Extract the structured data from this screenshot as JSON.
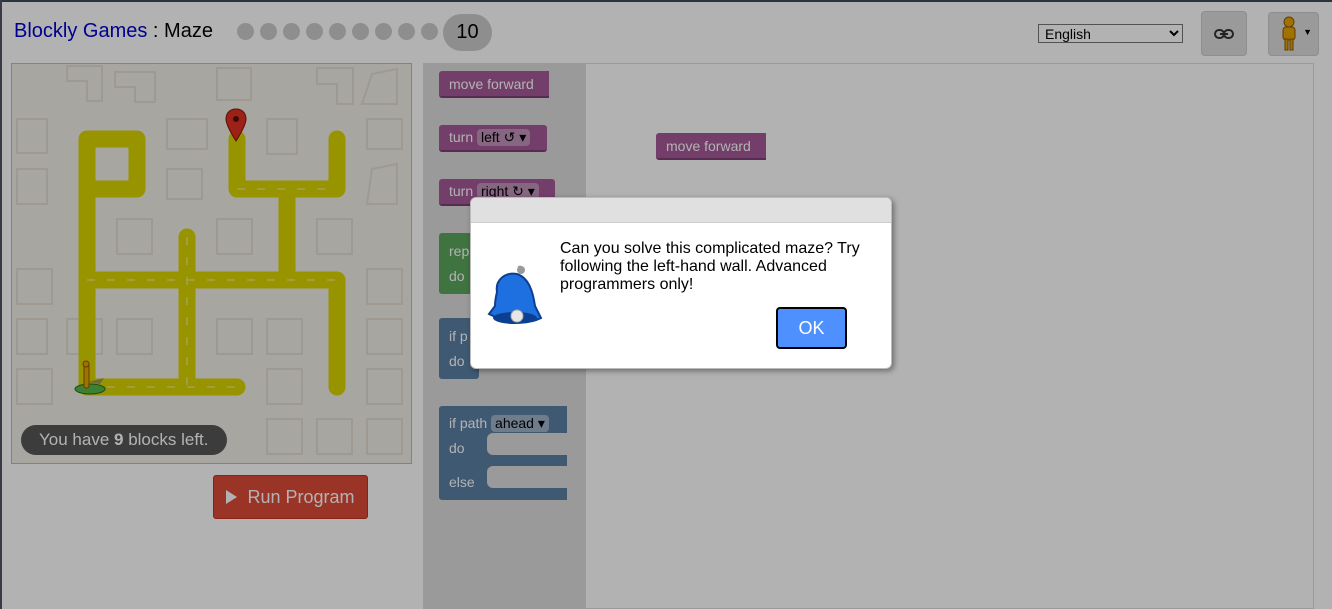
{
  "header": {
    "app_name": "Blockly Games",
    "separator": " : ",
    "game_name": "Maze",
    "levels": [
      "1",
      "2",
      "3",
      "4",
      "5",
      "6",
      "7",
      "8",
      "9",
      "10"
    ],
    "current_level": "10",
    "language": "English",
    "link_icon": "link-icon",
    "pegman_icon": "pegman-icon"
  },
  "maze": {
    "start_icon": "pegman-icon",
    "goal_icon": "map-marker-icon",
    "capacity_prefix": "You have ",
    "capacity_count": "9",
    "capacity_suffix": " blocks left."
  },
  "run_button": {
    "label": "Run Program",
    "icon": "play-icon"
  },
  "toolbox": {
    "move_forward": "move forward",
    "turn_label": "turn",
    "turn_left": "left ↺",
    "turn_right": "right ↻",
    "repeat_label": "rep",
    "repeat_do": "do",
    "if_label": "if p",
    "if_do": "do",
    "ifelse_if": "if path",
    "ifelse_dir": "ahead",
    "ifelse_do": "do",
    "ifelse_else": "else"
  },
  "workspace": {
    "block_label": "move forward"
  },
  "dialog": {
    "message": "Can you solve this complicated maze? Try following the left-hand wall. Advanced programmers only!",
    "ok_label": "OK",
    "icon": "bell-icon"
  },
  "colors": {
    "run_button": "#dd4b39",
    "ok_button": "#4d90fe",
    "motion_block": "#a55b99",
    "loop_block": "#5ba55b",
    "logic_block": "#5b80a5",
    "path": "#d8d400"
  }
}
